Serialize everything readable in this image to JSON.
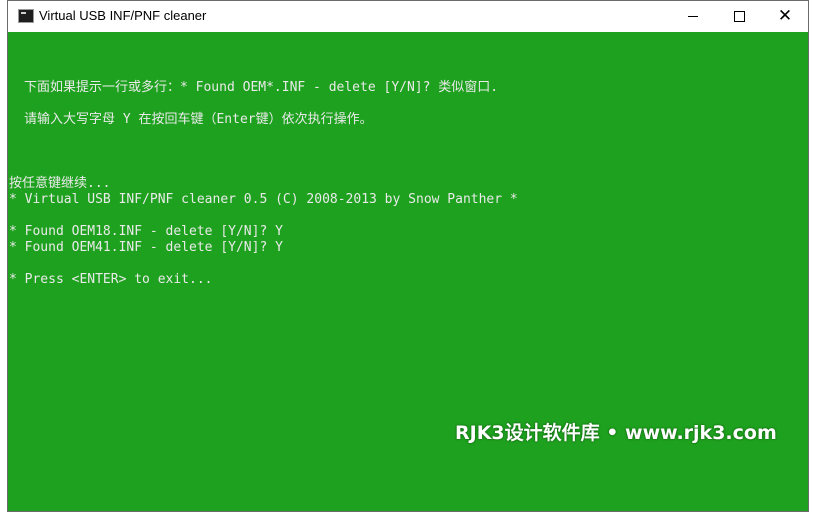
{
  "window": {
    "title": "Virtual USB INF/PNF cleaner",
    "icon": "console-app-icon",
    "controls": {
      "minimize": "minimize-icon",
      "maximize": "maximize-icon",
      "close": "close-icon"
    }
  },
  "console": {
    "background": "#1ea11e",
    "text_color": "#eaeaea",
    "lines": [
      "下面如果提示一行或多行：* Found OEM*.INF - delete [Y/N]? 类似窗口.",
      "请输入大写字母 Y 在按回车键（Enter键）依次执行操作。",
      "按任意键继续...",
      "* Virtual USB INF/PNF cleaner 0.5 (C) 2008-2013 by Snow Panther *",
      "* Found OEM18.INF - delete [Y/N]? Y",
      "* Found OEM41.INF - delete [Y/N]? Y",
      "* Press <ENTER> to exit..."
    ]
  },
  "watermark": "RJK3设计软件库 • www.rjk3.com"
}
